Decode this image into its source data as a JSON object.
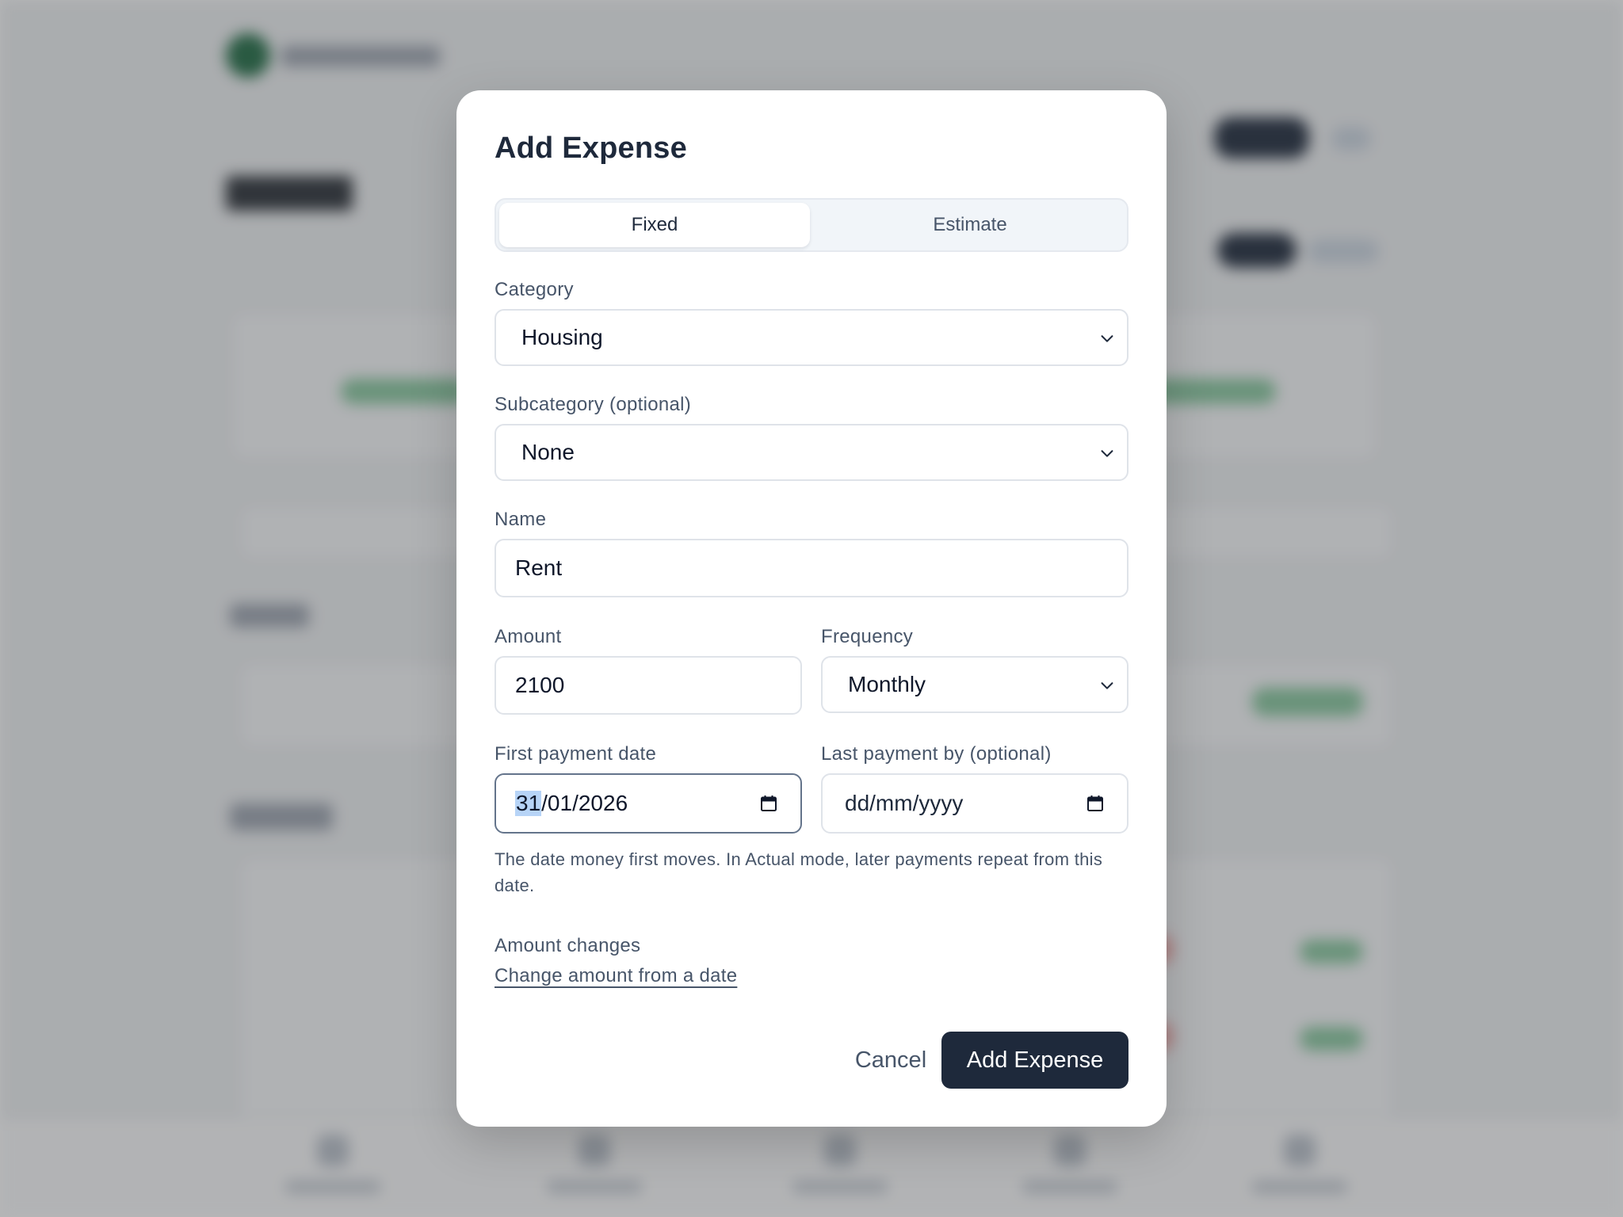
{
  "modal": {
    "title": "Add Expense",
    "mode_tabs": [
      {
        "label": "Fixed",
        "active": true
      },
      {
        "label": "Estimate",
        "active": false
      }
    ],
    "category": {
      "label": "Category",
      "value": "Housing"
    },
    "subcategory": {
      "label": "Subcategory (optional)",
      "value": "None"
    },
    "name": {
      "label": "Name",
      "value": "Rent"
    },
    "amount": {
      "label": "Amount",
      "value": "2100"
    },
    "frequency": {
      "label": "Frequency",
      "value": "Monthly"
    },
    "first_payment": {
      "label": "First payment date",
      "day": "31",
      "rest": "/01/2026"
    },
    "last_payment": {
      "label": "Last payment by (optional)",
      "placeholder": "dd/mm/yyyy"
    },
    "helper_text": "The date money first moves. In Actual mode, later payments repeat from this date.",
    "amount_changes": {
      "label": "Amount changes",
      "link": "Change amount from a date"
    },
    "cancel_label": "Cancel",
    "submit_label": "Add Expense"
  },
  "colors": {
    "primary": "#1e293b",
    "muted_text": "#475569",
    "border": "#dfe3e9",
    "date_selection": "#b7d4f7"
  },
  "icons": {
    "select": "chevron-down-icon",
    "date": "calendar-icon"
  }
}
